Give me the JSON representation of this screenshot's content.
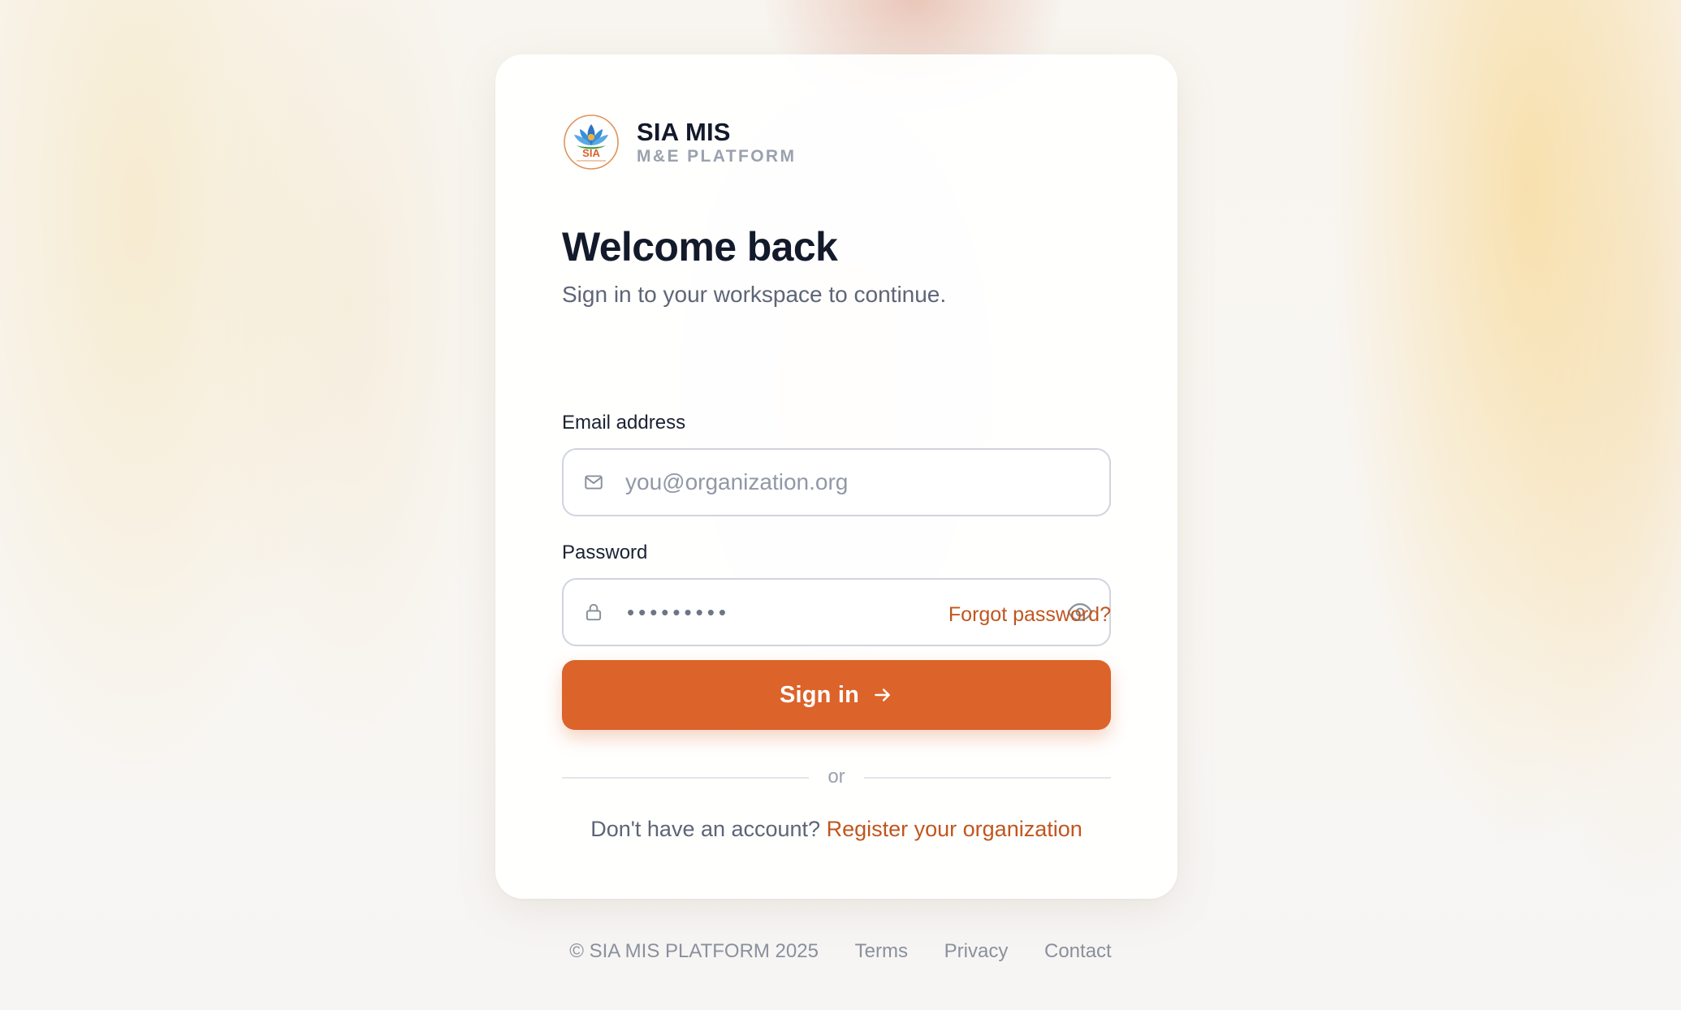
{
  "brand": {
    "name": "SIA MIS",
    "subtitle": "M&E PLATFORM",
    "logo_text": "SIA",
    "logo_icon": "lotus-logo-icon"
  },
  "header": {
    "title": "Welcome back",
    "subtitle": "Sign in to your workspace to continue."
  },
  "form": {
    "email": {
      "label": "Email address",
      "placeholder": "you@organization.org",
      "value": "",
      "icon": "mail-icon"
    },
    "password": {
      "label": "Password",
      "masked_value": "•••••••••",
      "icon": "lock-icon",
      "toggle_icon": "eye-icon"
    },
    "forgot_label": "Forgot password?",
    "submit_label": "Sign in",
    "submit_icon": "arrow-right-icon"
  },
  "divider_label": "or",
  "register": {
    "prompt": "Don't have an account?",
    "link_label": "Register your organization"
  },
  "footer": {
    "copyright": "© SIA MIS PLATFORM 2025",
    "links": [
      "Terms",
      "Privacy",
      "Contact"
    ]
  },
  "colors": {
    "accent": "#dc632a",
    "link": "#c0561e",
    "heading": "#121a2b",
    "muted": "#5d6577"
  }
}
